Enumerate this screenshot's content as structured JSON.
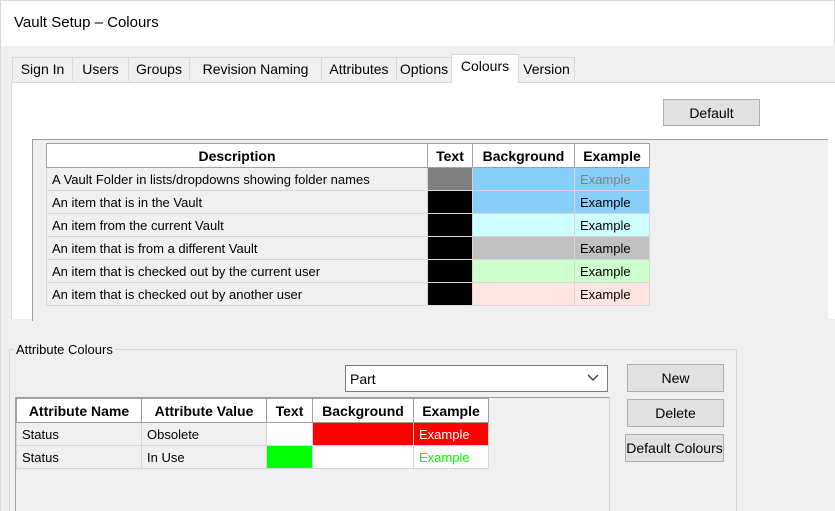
{
  "window": {
    "title": "Vault Setup – Colours"
  },
  "tabs": [
    {
      "label": "Sign In"
    },
    {
      "label": "Users"
    },
    {
      "label": "Groups"
    },
    {
      "label": "Revision Naming"
    },
    {
      "label": "Attributes"
    },
    {
      "label": "Options"
    },
    {
      "label": "Colours",
      "active": true
    },
    {
      "label": "Version"
    }
  ],
  "colours_panel": {
    "default_button": "Default",
    "columns": {
      "description": "Description",
      "text": "Text",
      "background": "Background",
      "example": "Example"
    },
    "rows": [
      {
        "description": "A Vault Folder in lists/dropdowns showing folder names",
        "text_color": "#808080",
        "background_color": "#87cefa",
        "example": "Example"
      },
      {
        "description": "An item that is in the Vault",
        "text_color": "#000000",
        "background_color": "#87cefa",
        "example": "Example"
      },
      {
        "description": "An item from the current Vault",
        "text_color": "#000000",
        "background_color": "#ccffff",
        "example": "Example"
      },
      {
        "description": "An item that is from a different Vault",
        "text_color": "#000000",
        "background_color": "#c0c0c0",
        "example": "Example"
      },
      {
        "description": "An item that is checked out by the current user",
        "text_color": "#000000",
        "background_color": "#ccffcc",
        "example": "Example"
      },
      {
        "description": "An item that is checked out by another user",
        "text_color": "#000000",
        "background_color": "#ffe4e1",
        "example": "Example"
      }
    ]
  },
  "attribute_colours": {
    "group_label": "Attribute Colours",
    "type_select": {
      "value": "Part"
    },
    "buttons": {
      "new": "New",
      "delete": "Delete",
      "default_colours": "Default Colours"
    },
    "columns": {
      "attribute_name": "Attribute Name",
      "attribute_value": "Attribute Value",
      "text": "Text",
      "background": "Background",
      "example": "Example"
    },
    "rows": [
      {
        "attribute_name": "Status",
        "attribute_value": "Obsolete",
        "text_color": "#ffffff",
        "background_color": "#ff0000",
        "example": "Example"
      },
      {
        "attribute_name": "Status",
        "attribute_value": "In Use",
        "text_color": "#00ff00",
        "background_color": "#ffffff",
        "example": "Example"
      }
    ]
  }
}
